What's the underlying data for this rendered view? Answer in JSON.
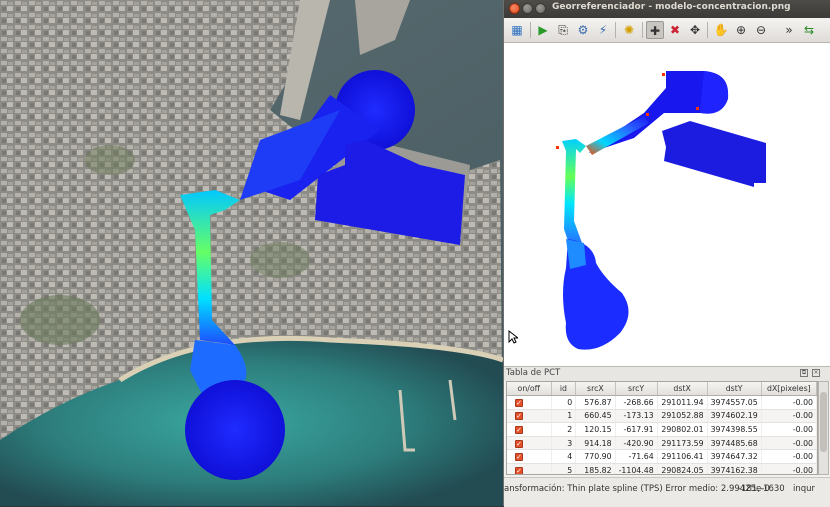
{
  "window": {
    "title": "Georreferenciador - modelo-concentracion.png"
  },
  "toolbar": {
    "buttons": [
      {
        "name": "add-raster-icon",
        "glyph": "▦"
      },
      {
        "name": "start-georef-icon",
        "glyph": "▶"
      },
      {
        "name": "gen-script-icon",
        "glyph": "⎘"
      },
      {
        "name": "settings-icon",
        "glyph": "⚙"
      },
      {
        "name": "transform-settings-icon",
        "glyph": "⚡"
      },
      {
        "name": "add-point-icon",
        "glyph": "✚"
      },
      {
        "name": "delete-point-icon",
        "glyph": "✖"
      },
      {
        "name": "move-gcp-icon",
        "glyph": "✥"
      },
      {
        "name": "pan-icon",
        "glyph": "✋"
      },
      {
        "name": "zoom-in-icon",
        "glyph": "⊕"
      },
      {
        "name": "zoom-out-icon",
        "glyph": "⊖"
      },
      {
        "name": "overflow-icon",
        "glyph": "»"
      },
      {
        "name": "link-qgis-icon",
        "glyph": "⇆"
      }
    ]
  },
  "pct_panel": {
    "title": "Tabla de PCT",
    "columns": [
      "on/off",
      "id",
      "srcX",
      "srcY",
      "dstX",
      "dstY",
      "dX[pixeles]"
    ],
    "rows": [
      {
        "on": true,
        "id": "0",
        "srcX": "576.87",
        "srcY": "-268.66",
        "dstX": "291011.94",
        "dstY": "3974557.05",
        "dX": "-0.00"
      },
      {
        "on": true,
        "id": "1",
        "srcX": "660.45",
        "srcY": "-173.13",
        "dstX": "291052.88",
        "dstY": "3974602.19",
        "dX": "-0.00"
      },
      {
        "on": true,
        "id": "2",
        "srcX": "120.15",
        "srcY": "-617.91",
        "dstX": "290802.01",
        "dstY": "3974398.55",
        "dX": "-0.00"
      },
      {
        "on": true,
        "id": "3",
        "srcX": "914.18",
        "srcY": "-420.90",
        "dstX": "291173.59",
        "dstY": "3974485.68",
        "dX": "-0.00"
      },
      {
        "on": true,
        "id": "4",
        "srcX": "770.90",
        "srcY": "-71.64",
        "dstX": "291106.41",
        "dstY": "3974647.32",
        "dX": "-0.00"
      },
      {
        "on": true,
        "id": "5",
        "srcX": "185.82",
        "srcY": "-1104.48",
        "dstX": "290824.05",
        "dstY": "3974162.38",
        "dX": "-0.00"
      }
    ]
  },
  "statusbar": {
    "transform_text": "ansformación: Thin plate spline (TPS) Error medio: 2.99425e-0",
    "coords": "-181,-1630",
    "unit": "inqur"
  },
  "colors": {
    "plume_core": "#1515ff",
    "plume_mid": "#00d0ff",
    "plume_hot": "#ff3300",
    "checkbox": "#e4502a"
  }
}
